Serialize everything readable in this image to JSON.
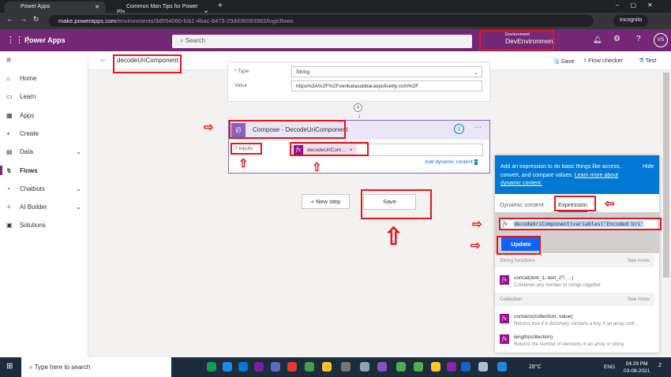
{
  "browser": {
    "tab1": "Power Apps",
    "tab2": "Common Man Tips for Power Pla",
    "url_host": "make.powerapps.com",
    "url_path": "/environments/3d554060-fcb1-4bac-8473-29dd36093983/logicflows",
    "incognito": "Incognito"
  },
  "header": {
    "app": "Power Apps",
    "search_placeholder": "Search",
    "env_label": "Environment",
    "env_name": "DevEnvironment",
    "avatar": "VS"
  },
  "command": {
    "flow_name": "decodeUriComponent",
    "save": "Save",
    "checker": "Flow checker",
    "test": "Test"
  },
  "sidebar": {
    "items": [
      {
        "label": "Home",
        "icon": "home-icon"
      },
      {
        "label": "Learn",
        "icon": "book-icon"
      },
      {
        "label": "Apps",
        "icon": "apps-icon"
      },
      {
        "label": "Create",
        "icon": "plus-icon"
      },
      {
        "label": "Data",
        "icon": "table-icon"
      },
      {
        "label": "Flows",
        "icon": "flow-icon"
      },
      {
        "label": "Chatbots",
        "icon": "chatbot-icon"
      },
      {
        "label": "AI Builder",
        "icon": "ai-icon"
      },
      {
        "label": "Solutions",
        "icon": "solutions-icon"
      }
    ]
  },
  "variable_card": {
    "type_label": "Type",
    "type_value": "String",
    "value_label": "Value",
    "value": "https%3A%2F%2Fvenkatasubbaraopolisetty.com%2F"
  },
  "compose": {
    "title": "Compose - DecodeUriComponent",
    "inputs_label": "Inputs",
    "token": "decodeUriCom...",
    "add_dynamic": "Add dynamic content"
  },
  "canvas": {
    "new_step": "+ New step",
    "save": "Save"
  },
  "panel": {
    "info": "Add an expression to do basic things like access, convert, and compare values.",
    "learn_more": "Learn more about dynamic content.",
    "hide": "Hide",
    "tab_dynamic": "Dynamic content",
    "tab_expression": "Expression",
    "expression": "decodeUriComponent(variables('Encoded Uri'",
    "update": "Update",
    "sections": [
      {
        "title": "String functions",
        "see_more": "See more",
        "items": [
          {
            "name": "concat(text_1, text_2?, ...)",
            "desc": "Combines any number of strings together"
          }
        ]
      },
      {
        "title": "Collection",
        "see_more": "See more",
        "items": [
          {
            "name": "contains(collection, value)",
            "desc": "Returns true if a dictionary contains a key, if an array cont..."
          },
          {
            "name": "length(collection)",
            "desc": "Returns the number of elements in an array or string"
          }
        ]
      }
    ]
  },
  "taskbar": {
    "search": "Type here to search",
    "temp": "28°C",
    "lang": "ENG",
    "time": "04:29 PM",
    "date": "03-08-2021",
    "notif": "2"
  }
}
